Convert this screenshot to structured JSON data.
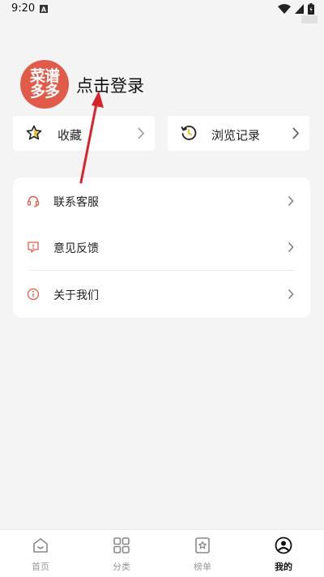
{
  "status_bar": {
    "time": "9:20"
  },
  "profile": {
    "avatar_line1": "菜谱",
    "avatar_line2": "多多",
    "login_text": "点击登录"
  },
  "cards": {
    "favorites": "收藏",
    "history": "浏览记录"
  },
  "menu": {
    "items": [
      {
        "label": "联系客服",
        "icon": "headset-icon"
      },
      {
        "label": "意见反馈",
        "icon": "feedback-icon"
      },
      {
        "label": "关于我们",
        "icon": "info-icon"
      }
    ]
  },
  "bottom_nav": {
    "items": [
      {
        "label": "首页",
        "icon": "home-icon"
      },
      {
        "label": "分类",
        "icon": "grid-icon"
      },
      {
        "label": "榜单",
        "icon": "ranking-icon"
      },
      {
        "label": "我的",
        "icon": "profile-icon",
        "active": true
      }
    ]
  },
  "colors": {
    "accent": "#e05b4a",
    "annotation_arrow": "#d8232a"
  }
}
